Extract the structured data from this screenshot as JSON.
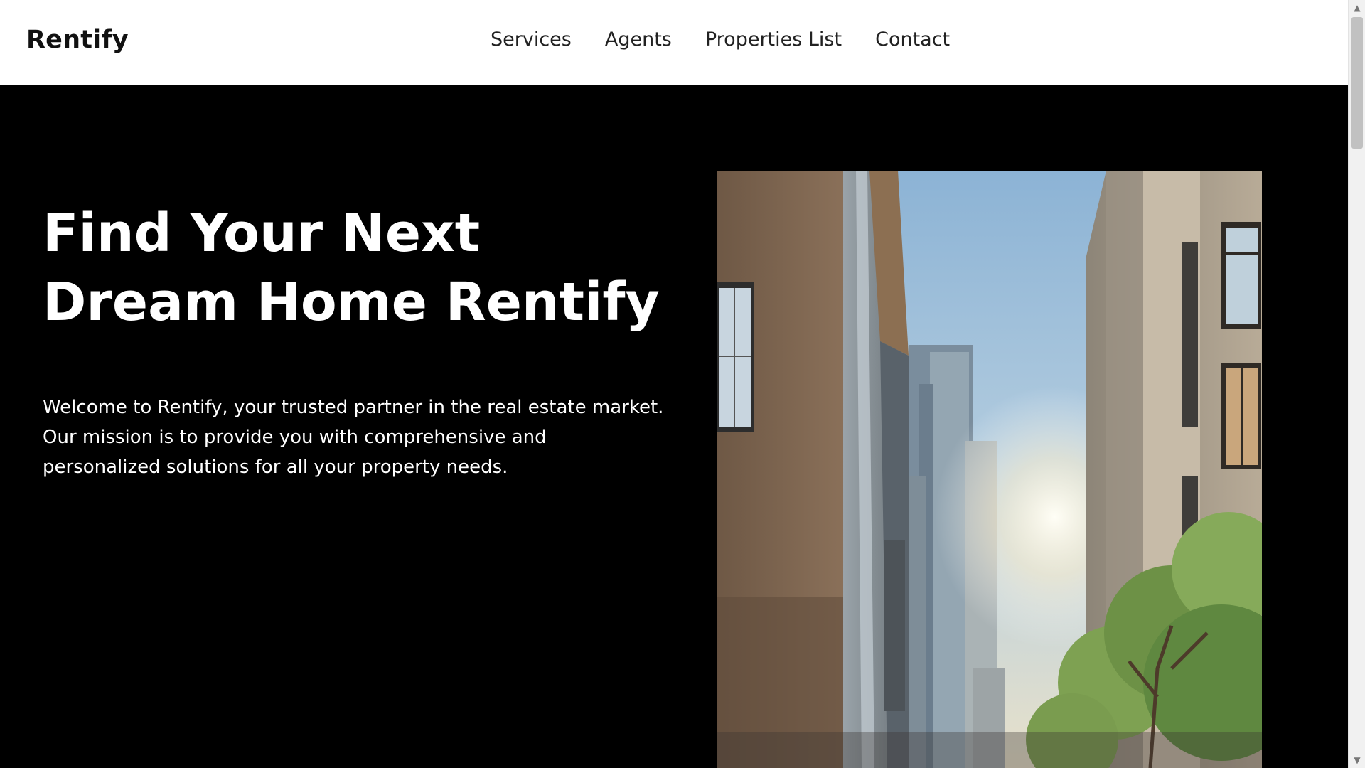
{
  "brand": {
    "name": "Rentify"
  },
  "nav": {
    "items": [
      {
        "label": "Services"
      },
      {
        "label": "Agents"
      },
      {
        "label": "Properties List"
      },
      {
        "label": "Contact"
      }
    ]
  },
  "hero": {
    "title_line_1": "Find Your Next",
    "title_line_2": "Dream Home Rentify",
    "description": "Welcome to Rentify, your trusted partner in the real estate market. Our mission is to provide you with comprehensive and personalized solutions for all your property needs."
  },
  "icons": {
    "scroll_up": "chevron-up-icon",
    "scroll_down": "chevron-down-icon"
  },
  "colors": {
    "header_bg": "#ffffff",
    "hero_bg": "#000000",
    "text_dark": "#111111",
    "text_light": "#ffffff"
  }
}
